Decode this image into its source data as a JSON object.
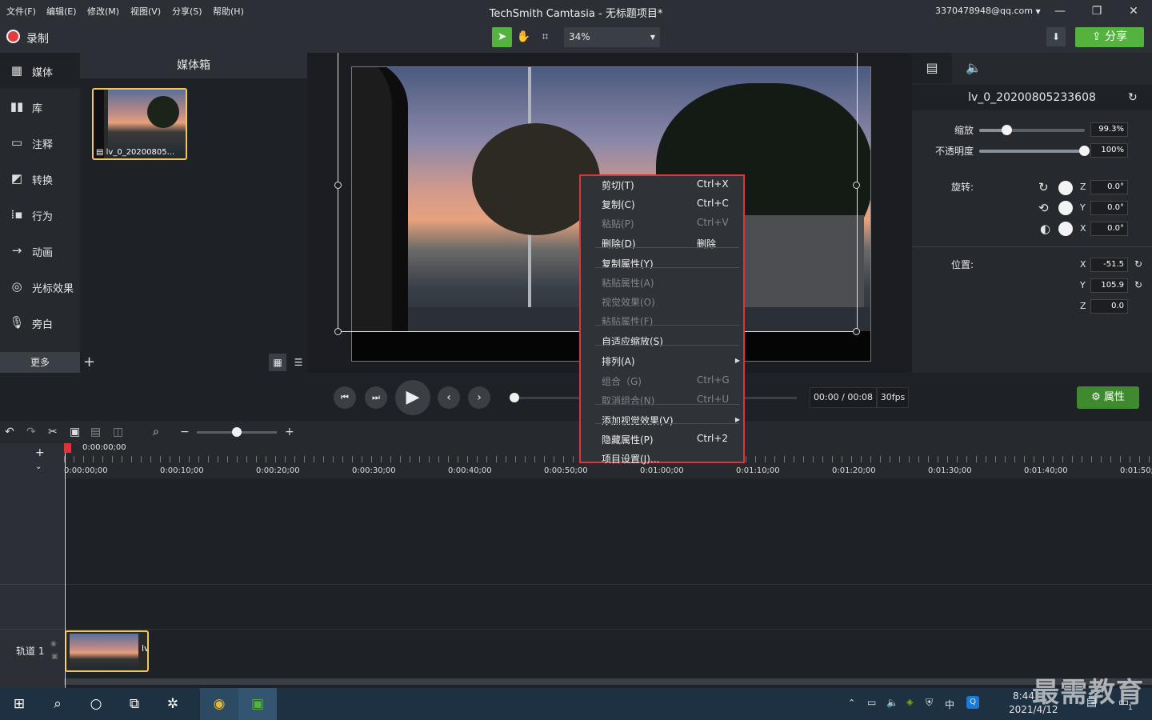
{
  "menu": [
    "文件(F)",
    "编辑(E)",
    "修改(M)",
    "视图(V)",
    "分享(S)",
    "帮助(H)"
  ],
  "app_title": "TechSmith Camtasia - 无标题项目*",
  "account": "3370478948@qq.com",
  "toolbar": {
    "record_label": "录制",
    "zoom_value": "34%",
    "share_label": "分享"
  },
  "nav": {
    "items": [
      "媒体",
      "库",
      "注释",
      "转换",
      "行为",
      "动画",
      "光标效果",
      "旁白"
    ],
    "more": "更多"
  },
  "media_bin": {
    "title": "媒体箱",
    "clip_label": "lv_0_20200805..."
  },
  "properties": {
    "clip_name": "lv_0_20200805233608",
    "scale_label": "缩放",
    "scale_value": "99.3%",
    "scale_fraction": 0.26,
    "opacity_label": "不透明度",
    "opacity_value": "100%",
    "opacity_fraction": 1.0,
    "rotation_label": "旋转:",
    "rot_z": "0.0°",
    "rot_y": "0.0°",
    "rot_x": "0.0°",
    "position_label": "位置:",
    "pos_x": "-51.5",
    "pos_y": "105.9",
    "pos_z": "0.0",
    "axis_z": "Z",
    "axis_y": "Y",
    "axis_x": "X"
  },
  "playback": {
    "timecode": "00:00 / 00:08",
    "fps": "30fps",
    "properties_button": "属性"
  },
  "timeline": {
    "playhead_time": "0:00:00;00",
    "ticks": [
      "0:00:00;00",
      "0:00:10;00",
      "0:00:20;00",
      "0:00:30;00",
      "0:00:40;00",
      "0:00:50;00",
      "0:01:00;00",
      "0:01:10;00",
      "0:01:20;00",
      "0:01:30;00",
      "0:01:40;00",
      "0:01:50;"
    ],
    "track_label": "轨道 1",
    "clip_edge_label": "lv"
  },
  "context_menu": [
    {
      "label": "剪切(T)",
      "shortcut": "Ctrl+X",
      "enabled": true
    },
    {
      "label": "复制(C)",
      "shortcut": "Ctrl+C",
      "enabled": true
    },
    {
      "label": "粘贴(P)",
      "shortcut": "Ctrl+V",
      "enabled": false
    },
    {
      "label": "删除(D)",
      "shortcut": "删除",
      "enabled": true
    },
    {
      "label": "复制属性(Y)",
      "shortcut": "",
      "enabled": true
    },
    {
      "label": "粘贴属性(A)",
      "shortcut": "",
      "enabled": false
    },
    {
      "label": "视觉效果(O)",
      "shortcut": "",
      "enabled": false
    },
    {
      "label": "粘贴属性(F)",
      "shortcut": "",
      "enabled": false
    },
    {
      "label": "自适应缩放(S)",
      "shortcut": "",
      "enabled": true
    },
    {
      "label": "排列(A)",
      "shortcut": "",
      "enabled": true,
      "submenu": true
    },
    {
      "label": "组合（G)",
      "shortcut": "Ctrl+G",
      "enabled": false
    },
    {
      "label": "取消组合(N)",
      "shortcut": "Ctrl+U",
      "enabled": false
    },
    {
      "label": "添加视觉效果(V)",
      "shortcut": "",
      "enabled": true,
      "submenu": true
    },
    {
      "label": "隐藏属性(P)",
      "shortcut": "Ctrl+2",
      "enabled": true
    },
    {
      "label": "项目设置(J)...",
      "shortcut": "",
      "enabled": true
    }
  ],
  "taskbar": {
    "time": "8:44",
    "date": "2021/4/12",
    "ime": "中",
    "notif_count": "1"
  },
  "watermark": "最需教育",
  "colors": {
    "accent_green": "#54b33e",
    "record_red": "#e23b3b",
    "menu_highlight_border": "#d9353b",
    "selection_yellow": "#f0c85a"
  }
}
